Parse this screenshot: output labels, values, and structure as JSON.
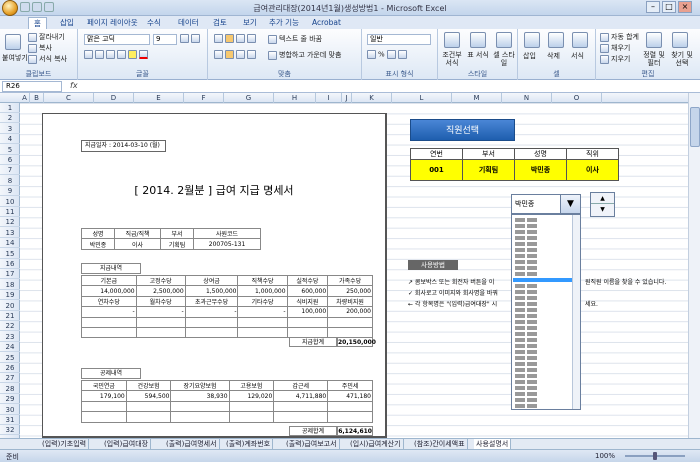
{
  "window": {
    "title": "급여관리대장(2014년1월)생성방법1 - Microsoft Excel",
    "min": "–",
    "max": "□",
    "close": "×"
  },
  "tabs": [
    "홈",
    "삽입",
    "페이지 레이아웃",
    "수식",
    "데이터",
    "검토",
    "보기",
    "추가 기능",
    "Acrobat"
  ],
  "ribbon": {
    "paste": "붙여넣기",
    "cut": "잘라내기",
    "copy": "복사",
    "format_painter": "서식 복사",
    "clipboard": "클립보드",
    "font_name": "맑은 고딕",
    "font_size": "9",
    "font": "글꼴",
    "wrap": "텍스트 줄 바꿈",
    "merge": "병합하고 가운데 맞춤",
    "align": "맞춤",
    "number_format": "일반",
    "number": "표시 형식",
    "percent": "%",
    "cond": "조건부 서식",
    "table": "표 서식",
    "cell_style": "셀 스타일",
    "style": "스타일",
    "insert": "삽입",
    "delete": "삭제",
    "format": "서식",
    "cell": "셀",
    "autosum": "자동 합계",
    "fill": "채우기",
    "clear": "지우기",
    "sort": "정렬 및 필터",
    "find": "찾기 및 선택",
    "edit": "편집"
  },
  "formula_bar": {
    "namebox": "R26",
    "fx": "fx"
  },
  "columns": [
    "A",
    "B",
    "C",
    "D",
    "E",
    "F",
    "G",
    "H",
    "I",
    "J",
    "K",
    "L",
    "M",
    "N",
    "O"
  ],
  "rows": [
    "1",
    "2",
    "3",
    "4",
    "5",
    "6",
    "7",
    "8",
    "9",
    "10",
    "11",
    "12",
    "13",
    "14",
    "15",
    "16",
    "17",
    "18",
    "19",
    "20",
    "21",
    "22",
    "23",
    "24",
    "25",
    "26",
    "27",
    "28",
    "29",
    "30",
    "31",
    "32"
  ],
  "payslip": {
    "pay_date": "지급일자 : 2014-03-10 (월)",
    "title": "[ 2014. 2월분 ]  급여 지급 명세서",
    "info_header": [
      "성명",
      "직급/직책",
      "부서",
      "사원코드"
    ],
    "info_values": [
      "박민종",
      "이사",
      "기획팀",
      "200705-131"
    ],
    "pay_section": "지급내역",
    "pay_row1_labels": [
      "기본급",
      "고정수당",
      "상여금",
      "직책수당",
      "실적수당",
      "가족수당"
    ],
    "pay_row1_values": [
      "14,000,000",
      "2,500,000",
      "1,500,000",
      "1,000,000",
      "600,000",
      "250,000"
    ],
    "pay_row2_labels": [
      "연차수당",
      "월차수당",
      "초과근무수당",
      "기타수당",
      "식비지원",
      "차량비지원"
    ],
    "pay_row2_values": [
      "-",
      "-",
      "-",
      "-",
      "100,000",
      "200,000"
    ],
    "pay_total_label": "지급합계",
    "pay_total_value": "20,150,000",
    "ded_section": "공제내역",
    "ded_labels": [
      "국민연금",
      "건강보험",
      "장기요양보험",
      "고용보험",
      "갑근세",
      "주민세"
    ],
    "ded_values": [
      "179,100",
      "594,500",
      "38,930",
      "129,020",
      "4,711,880",
      "471,180"
    ],
    "ded_total_label": "공제합계",
    "ded_total_value": "6,124,610"
  },
  "selector": {
    "button": "직원선택",
    "headers": [
      "연번",
      "부서",
      "성명",
      "직위"
    ],
    "values": [
      "001",
      "기획팀",
      "박민종",
      "이사"
    ],
    "combo_value": "박민종",
    "combo_arrow": "▼",
    "spin_up": "▲",
    "spin_down": "▼"
  },
  "help": {
    "title": "사용방법",
    "line1": "↗ 콤보박스 또는 회전자 버튼을 이",
    "line1_end": "원직원 이름을 찾을 수 있습니다.",
    "line2": "✓ 회사로고 이미지와 회사명을 바꿔",
    "line3": "← 각 항목명은 \"(입력)급여대장\" 시",
    "line3_end": "세요."
  },
  "sheets": [
    "(입력)기초입력",
    "(입력)급여대장",
    "(출력)급여명세서",
    "(출력)계좌번호",
    "(출력)급여보고서",
    "(입시)급여계산기",
    "(참조)간이세액표",
    "사용설명서"
  ],
  "status": {
    "ready": "준비",
    "zoom": "100%"
  }
}
